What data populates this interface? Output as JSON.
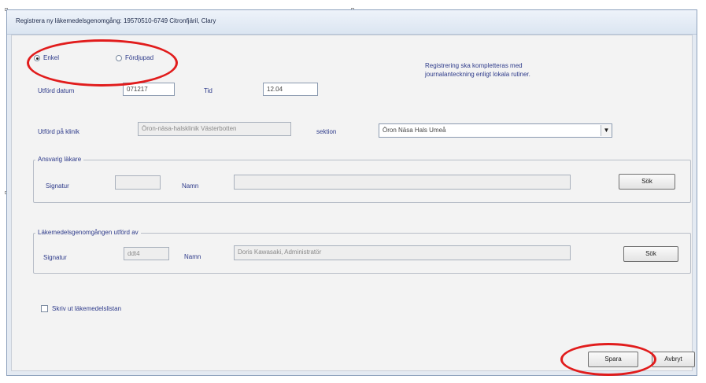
{
  "window": {
    "title": "Registrera ny läkemedelsgenomgång: 19570510-6749 Citronfjäril, Clary"
  },
  "form": {
    "radio_enkel": "Enkel",
    "radio_fordjupad": "Fördjupad",
    "info_text_line1": "Registrering ska kompletteras med",
    "info_text_line2": "journalanteckning enligt lokala rutiner.",
    "utford_datum_label": "Utförd datum",
    "utford_datum_value": "071217",
    "tid_label": "Tid",
    "tid_value": "12.04",
    "utford_klinik_label": "Utförd på klinik",
    "utford_klinik_value": "Öron-näsa-halsklinik Västerbotten",
    "sektion_label": "sektion",
    "sektion_value": "Öron Näsa Hals Umeå",
    "ansvarig_group_title": "Ansvarig läkare",
    "ansvarig_signatur_label": "Signatur",
    "ansvarig_signatur_value": "",
    "ansvarig_namn_label": "Namn",
    "ansvarig_namn_value": "",
    "ansvarig_sok_button": "Sök",
    "utford_av_group_title": "Läkemedelsgenomgången utförd av",
    "utford_av_signatur_label": "Signatur",
    "utford_av_signatur_value": "ddt4",
    "utford_av_namn_label": "Namn",
    "utford_av_namn_value": "Doris Kawasaki, Administratör",
    "utford_av_sok_button": "Sök",
    "skriv_ut_label": "Skriv ut läkemedelslistan"
  },
  "buttons": {
    "spara": "Spara",
    "avbryt": "Avbryt"
  },
  "colors": {
    "annotation_red": "#e11c1c",
    "label_blue": "#2d3a8a"
  }
}
